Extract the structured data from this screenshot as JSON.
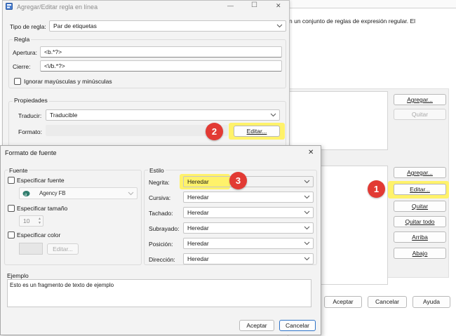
{
  "colors": {
    "highlight": "#fff26a",
    "badge": "#e23a34",
    "primary_border": "#2e73c7"
  },
  "bg": {
    "description_text": "n un conjunto de reglas de expresión regular. El",
    "add_top": "Agregar...",
    "remove_top": "Quitar",
    "add": "Agregar...",
    "edit": "Editar...",
    "remove": "Quitar",
    "remove_all": "Quitar todo",
    "up": "Arriba",
    "down": "Abajo",
    "accept": "Aceptar",
    "cancel": "Cancelar",
    "help": "Ayuda"
  },
  "rule_dialog": {
    "title": "Agregar/Editar regla en línea",
    "controls": {
      "minimize": "—",
      "maximize": "☐",
      "close": "✕"
    },
    "rule_type_label": "Tipo de regla:",
    "rule_type_value": "Par de etiquetas",
    "rule_group_label": "Regla",
    "opening_label": "Apertura:",
    "opening_value": "<b.*?>",
    "closing_label": "Cierre:",
    "closing_value": "<\\/b.*?>",
    "ignore_case_label": "Ignorar mayúsculas y minúsculas",
    "properties_label": "Propiedades",
    "translate_label": "Traducir:",
    "translate_value": "Traducible",
    "format_label": "Formato:",
    "edit_button": "Editar..."
  },
  "font_dialog": {
    "title": "Formato de fuente",
    "close": "✕",
    "font_group": "Fuente",
    "specify_font": "Especificar fuente",
    "font_value": "Agency FB",
    "specify_size": "Especificar tamaño",
    "size_value": "10",
    "specify_color": "Especificar color",
    "color_edit": "Editar...",
    "style_group": "Estilo",
    "styles": [
      {
        "label": "Negrita:",
        "value": "Heredar"
      },
      {
        "label": "Cursiva:",
        "value": "Heredar"
      },
      {
        "label": "Tachado:",
        "value": "Heredar"
      },
      {
        "label": "Subrayado:",
        "value": "Heredar"
      },
      {
        "label": "Posición:",
        "value": "Heredar"
      },
      {
        "label": "Dirección:",
        "value": "Heredar"
      }
    ],
    "example_label": "Ejemplo",
    "example_text": "Esto es un fragmento de texto de ejemplo",
    "accept": "Aceptar",
    "cancel": "Cancelar"
  },
  "badges": {
    "one": "1",
    "two": "2",
    "three": "3"
  }
}
